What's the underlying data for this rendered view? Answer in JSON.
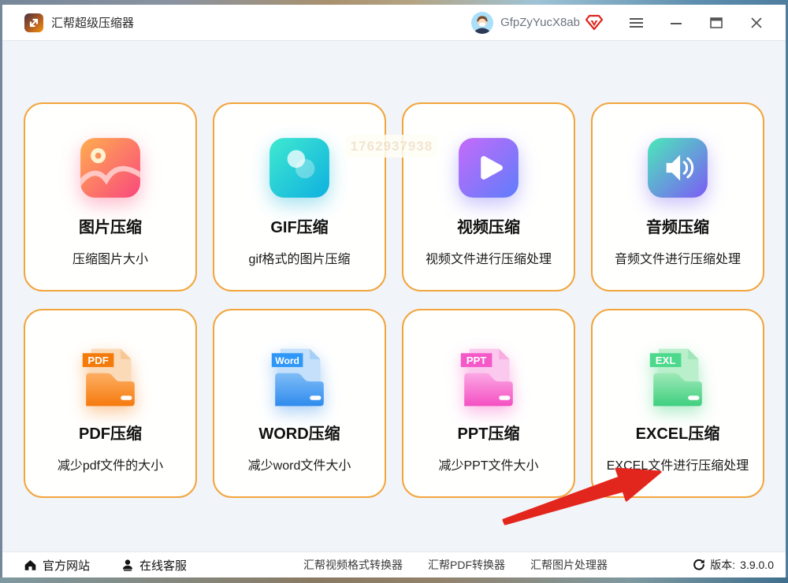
{
  "window": {
    "title": "汇帮超级压缩器",
    "user": {
      "name": "GfpZyYucX8ab"
    }
  },
  "colors": {
    "card_border": "#F2A53C",
    "content_background": "#F1F4F9",
    "titlebar_background": "#FFFFFF",
    "arrow_annotation": "#E3261D",
    "vip_badge": "#E0251C"
  },
  "cards": [
    {
      "icon": "image-compress-icon",
      "title": "图片压缩",
      "subtitle": "压缩图片大小"
    },
    {
      "icon": "gif-compress-icon",
      "title": "GIF压缩",
      "subtitle": "gif格式的图片压缩"
    },
    {
      "icon": "video-compress-icon",
      "title": "视频压缩",
      "subtitle": "视频文件进行压缩处理"
    },
    {
      "icon": "audio-compress-icon",
      "title": "音频压缩",
      "subtitle": "音频文件进行压缩处理"
    },
    {
      "icon": "pdf-folder-icon",
      "badge": "PDF",
      "title": "PDF压缩",
      "subtitle": "减少pdf文件的大小"
    },
    {
      "icon": "word-folder-icon",
      "badge": "Word",
      "title": "WORD压缩",
      "subtitle": "减少word文件大小"
    },
    {
      "icon": "ppt-folder-icon",
      "badge": "PPT",
      "title": "PPT压缩",
      "subtitle": "减少PPT文件大小"
    },
    {
      "icon": "excel-folder-icon",
      "badge": "EXL",
      "title": "EXCEL压缩",
      "subtitle": "EXCEL文件进行压缩处理"
    }
  ],
  "watermark": {
    "text": "1762937938"
  },
  "footer": {
    "official_site": "官方网站",
    "online_service": "在线客服",
    "links": {
      "video_converter": "汇帮视频格式转换器",
      "pdf_converter": "汇帮PDF转换器",
      "image_processor": "汇帮图片处理器"
    },
    "version_label": "版本:",
    "version": "3.9.0.0"
  }
}
